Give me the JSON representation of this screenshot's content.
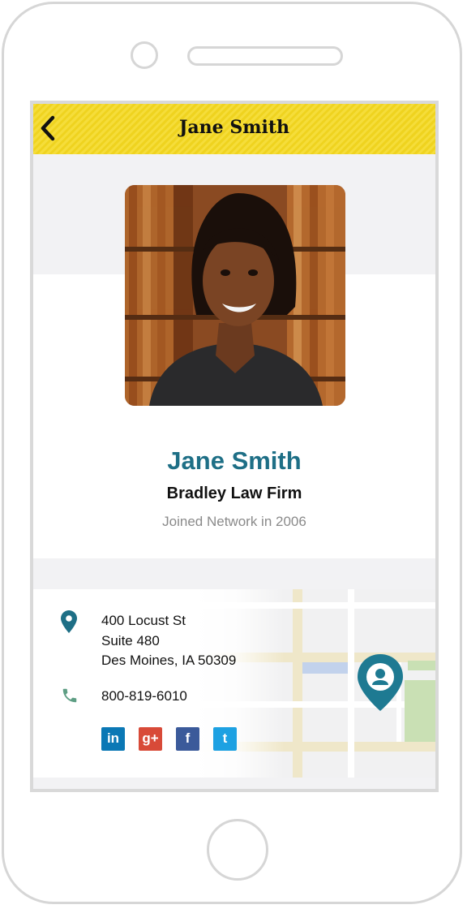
{
  "header": {
    "title": "Jane Smith",
    "back_icon": "chevron-left-icon"
  },
  "profile": {
    "name": "Jane Smith",
    "firm": "Bradley Law Firm",
    "joined": "Joined Network in 2006",
    "photo": "attorney-portrait-photo"
  },
  "contact": {
    "address_line1": "400 Locust St",
    "address_line2": "Suite 480",
    "address_line3": "Des Moines, IA 50309",
    "phone": "800-819-6010",
    "address_icon": "map-pin-icon",
    "phone_icon": "phone-icon"
  },
  "social": [
    {
      "name": "LinkedIn",
      "glyph": "in",
      "color": "#0b78b5"
    },
    {
      "name": "Google Plus",
      "glyph": "g+",
      "color": "#d84a38"
    },
    {
      "name": "Facebook",
      "glyph": "f",
      "color": "#3b5a9a"
    },
    {
      "name": "Twitter",
      "glyph": "t",
      "color": "#1da1e2"
    }
  ],
  "colors": {
    "header_bg": "#f2d72a",
    "name_text": "#1e6f86",
    "map_marker": "#1e7a92"
  }
}
